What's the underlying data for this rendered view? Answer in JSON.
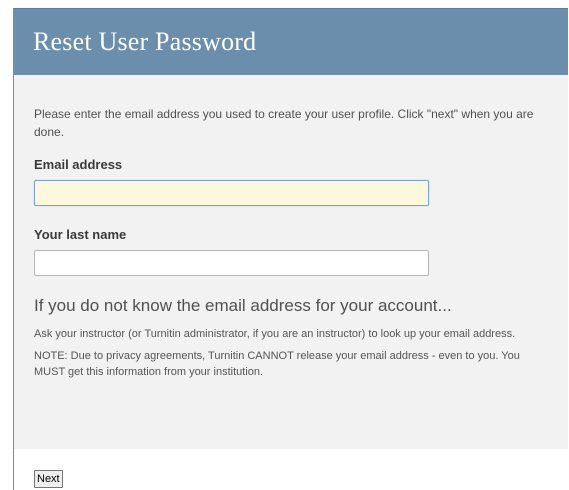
{
  "header": {
    "title": "Reset User Password"
  },
  "form": {
    "intro": "Please enter the email address you used to create your user profile. Click \"next\" when you are done.",
    "email": {
      "label": "Email address",
      "value": ""
    },
    "last_name": {
      "label": "Your last name",
      "value": ""
    }
  },
  "help": {
    "heading": "If you do not know the email address for your account...",
    "paragraph1": "Ask your instructor (or Turnitin administrator, if you are an instructor) to look up your email address.",
    "paragraph2": "NOTE: Due to privacy agreements, Turnitin CANNOT release your email address - even to you. You MUST get this information from your institution."
  },
  "footer": {
    "next_label": "Next"
  },
  "colors": {
    "header_bg": "#6a8eab",
    "focused_input_bg": "#fcf8dd"
  }
}
